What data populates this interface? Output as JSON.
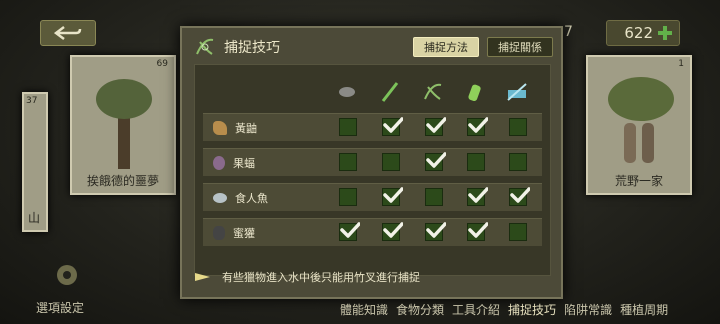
{
  "header": {
    "back_icon": "back-arrow-icon",
    "badge_left": "7",
    "count": "622",
    "add_icon": "plus-icon"
  },
  "cards": [
    {
      "tag": "69",
      "caption": "挨餓德的噩夢"
    },
    {
      "tag": "37",
      "caption": "山"
    },
    {
      "tag": "1",
      "caption": "荒野一家"
    }
  ],
  "panel": {
    "title": "捕捉技巧",
    "tabs": [
      "捕捉方法",
      "捕捉關係"
    ],
    "tool_icons": [
      "stone-icon",
      "stick-icon",
      "snare-icon",
      "bamboo-icon",
      "net-icon"
    ],
    "rows": [
      {
        "name": "黃鼬",
        "icon": "weasel-icon",
        "checks": [
          false,
          true,
          true,
          true,
          false
        ]
      },
      {
        "name": "果蝠",
        "icon": "bat-icon",
        "checks": [
          false,
          false,
          true,
          false,
          false
        ]
      },
      {
        "name": "食人魚",
        "icon": "piranha-icon",
        "checks": [
          false,
          true,
          false,
          true,
          true
        ]
      },
      {
        "name": "蜜獾",
        "icon": "badger-icon",
        "checks": [
          true,
          true,
          true,
          true,
          false
        ]
      }
    ],
    "note": "有些獵物進入水中後只能用竹叉進行捕捉"
  },
  "footer": {
    "options": "選項設定",
    "nav": [
      "體能知識",
      "食物分類",
      "工具介紹",
      "捕捉技巧",
      "陷阱常識",
      "種植周期"
    ]
  }
}
